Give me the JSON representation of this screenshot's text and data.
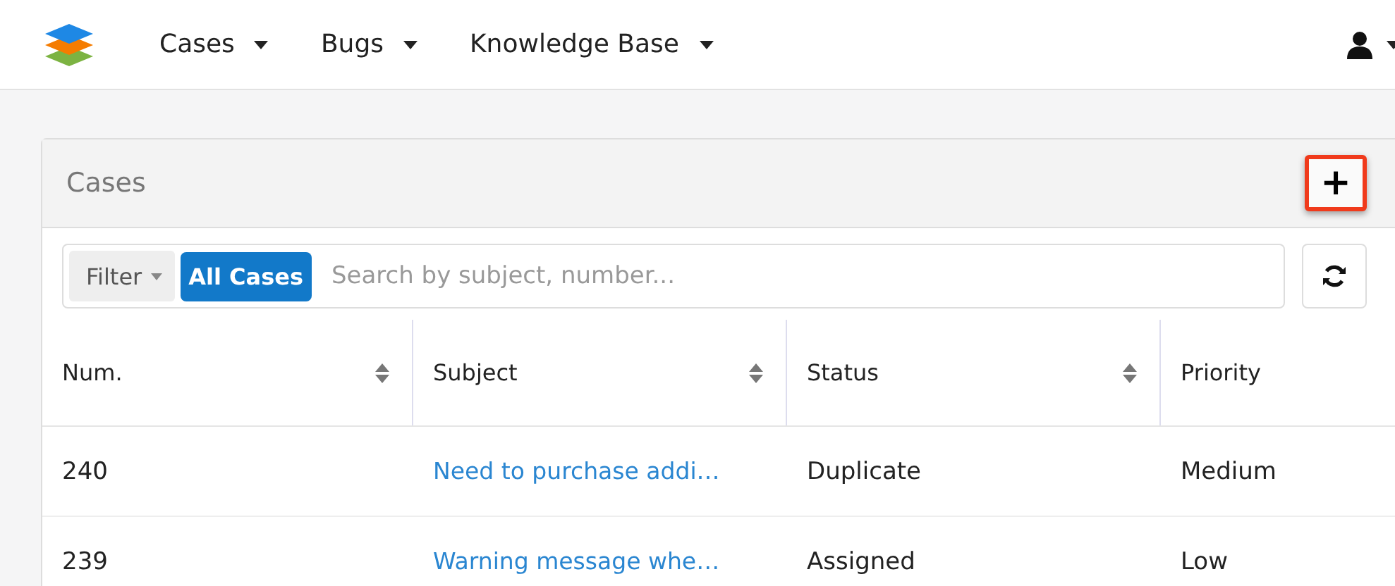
{
  "nav": {
    "items": [
      {
        "label": "Cases"
      },
      {
        "label": "Bugs"
      },
      {
        "label": "Knowledge Base"
      }
    ]
  },
  "panel": {
    "title": "Cases",
    "add_button": {
      "label": "+",
      "highlighted": true
    }
  },
  "filter": {
    "label": "Filter",
    "tag": "All Cases",
    "search": {
      "placeholder": "Search by subject, number..."
    }
  },
  "table": {
    "columns": [
      {
        "label": "Num.",
        "sortable": true
      },
      {
        "label": "Subject",
        "sortable": true
      },
      {
        "label": "Status",
        "sortable": true
      },
      {
        "label": "Priority",
        "sortable": false
      }
    ],
    "rows": [
      {
        "cells": [
          "240",
          "Need to purchase addi…",
          "Duplicate",
          "Medium"
        ]
      },
      {
        "cells": [
          "239",
          "Warning message whe…",
          "Assigned",
          "Low"
        ]
      }
    ]
  }
}
